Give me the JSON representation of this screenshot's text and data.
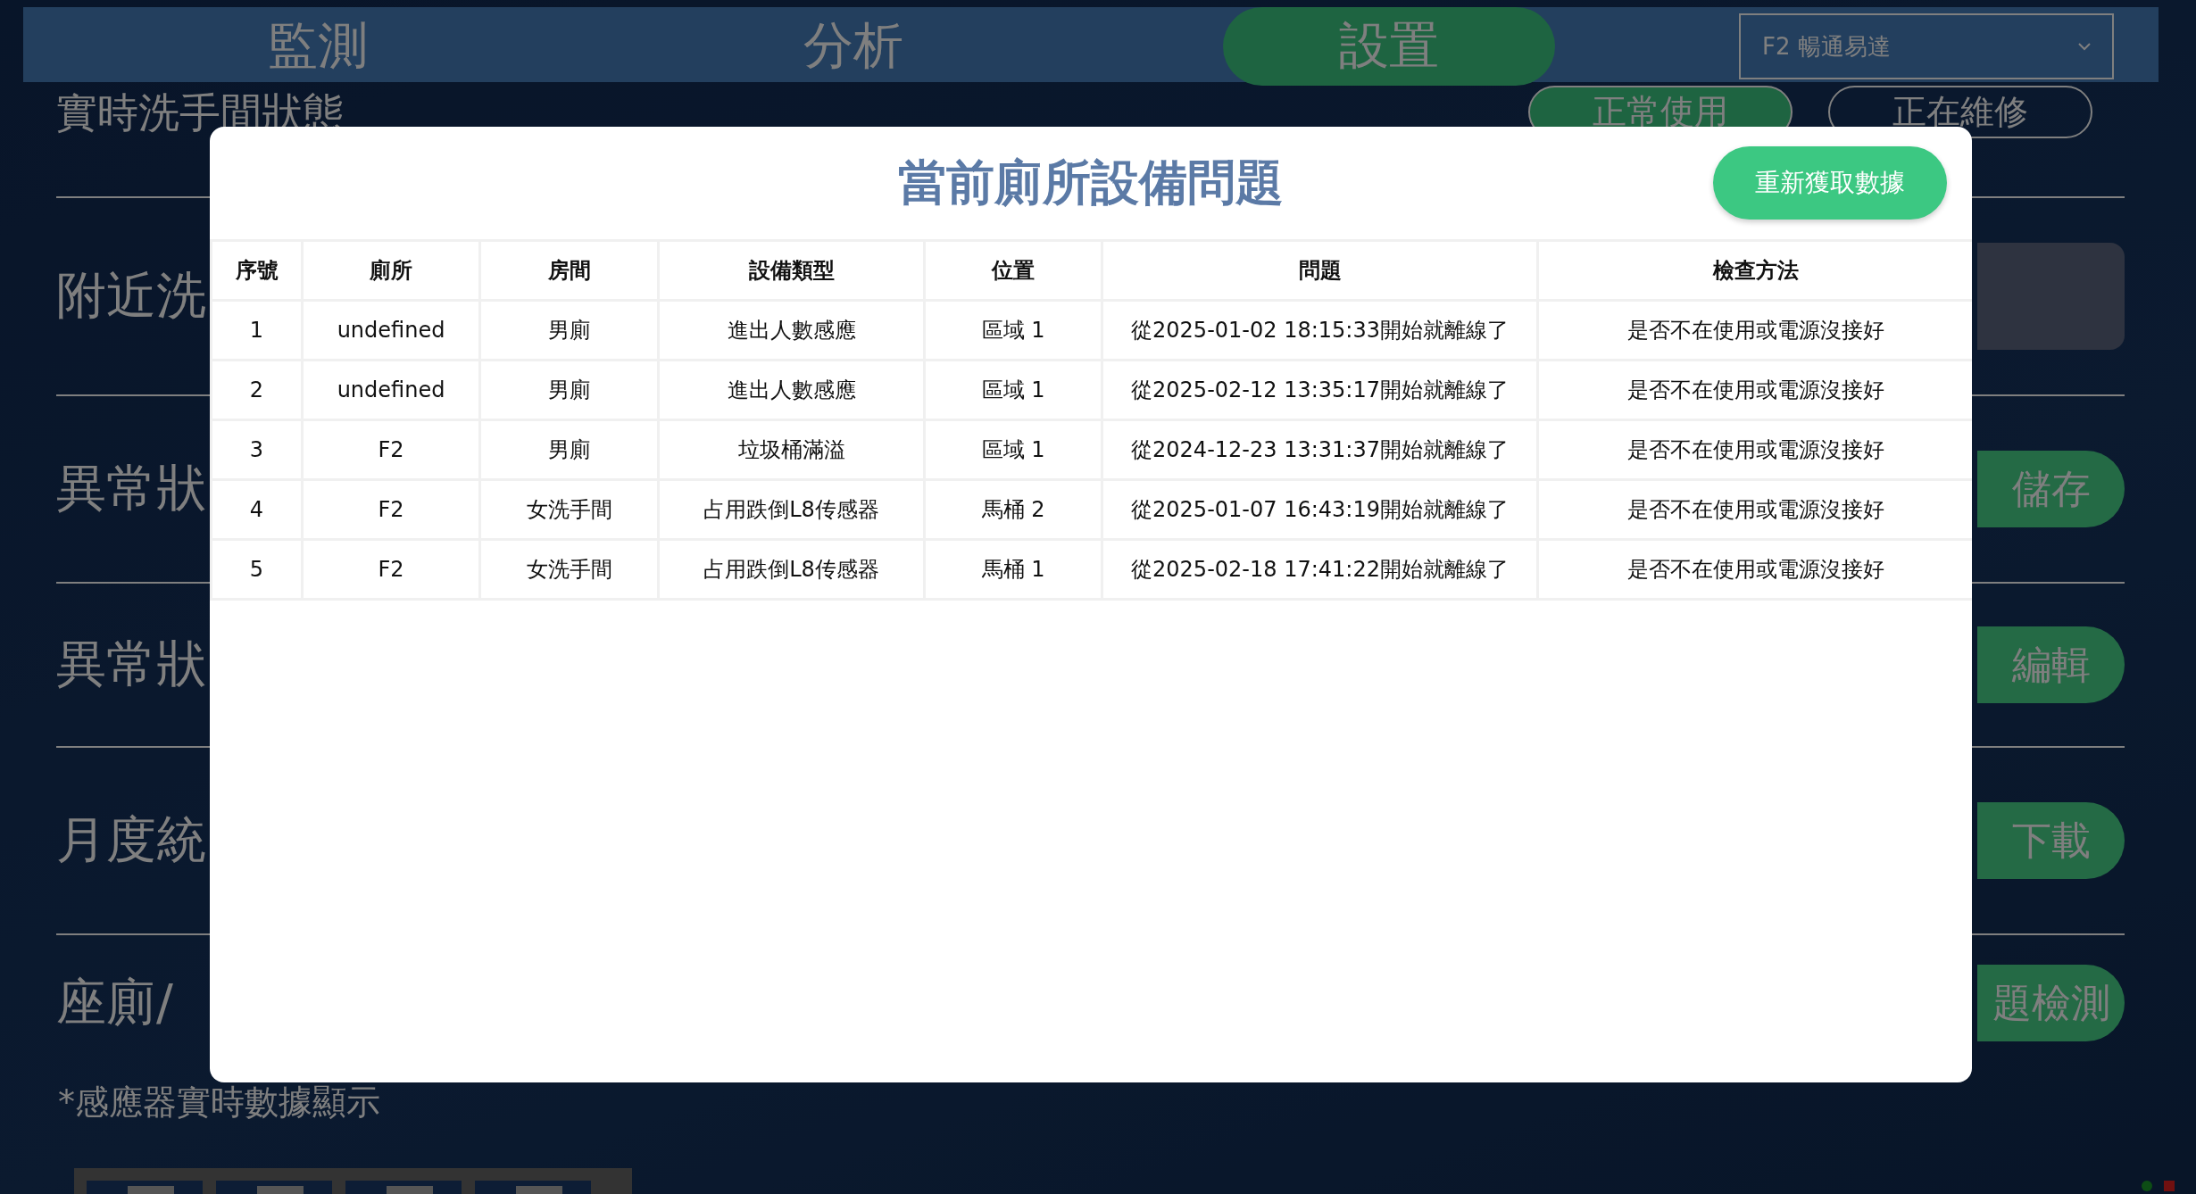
{
  "nav": {
    "tabs": [
      {
        "label": "監測",
        "selected": false
      },
      {
        "label": "分析",
        "selected": false
      },
      {
        "label": "設置",
        "selected": true
      }
    ],
    "building_select": {
      "value": "F2 暢通易達"
    }
  },
  "page": {
    "heading": "實時洗手間狀態",
    "status_pills": [
      {
        "label": "正常使用",
        "selected": true
      },
      {
        "label": "正在維修",
        "selected": false
      }
    ],
    "sections": [
      {
        "label": "附近洗",
        "kind": "panel"
      },
      {
        "label": "異常狀",
        "kind": "button",
        "button": "儲存"
      },
      {
        "label": "異常狀",
        "kind": "button",
        "button": "編輯"
      },
      {
        "label": "月度統",
        "kind": "button",
        "button": "下載"
      },
      {
        "label": "座廁/",
        "kind": "button",
        "button": "題檢測"
      }
    ],
    "footnote": "*感應器實時數據顯示"
  },
  "modal": {
    "title": "當前廁所設備問題",
    "refresh_button": "重新獲取數據",
    "table": {
      "columns": [
        "序號",
        "廁所",
        "房間",
        "設備類型",
        "位置",
        "問題",
        "檢查方法"
      ],
      "rows": [
        [
          "1",
          "undefined",
          "男廁",
          "進出人數感應",
          "區域 1",
          "從2025-01-02 18:15:33開始就離線了",
          "是否不在使用或電源沒接好"
        ],
        [
          "2",
          "undefined",
          "男廁",
          "進出人數感應",
          "區域 1",
          "從2025-02-12 13:35:17開始就離線了",
          "是否不在使用或電源沒接好"
        ],
        [
          "3",
          "F2",
          "男廁",
          "垃圾桶滿溢",
          "區域 1",
          "從2024-12-23 13:31:37開始就離線了",
          "是否不在使用或電源沒接好"
        ],
        [
          "4",
          "F2",
          "女洗手間",
          "占用跌倒L8传感器",
          "馬桶 2",
          "從2025-01-07 16:43:19開始就離線了",
          "是否不在使用或電源沒接好"
        ],
        [
          "5",
          "F2",
          "女洗手間",
          "占用跌倒L8传感器",
          "馬桶 1",
          "從2025-02-18 17:41:22開始就離線了",
          "是否不在使用或電源沒接好"
        ]
      ]
    }
  }
}
